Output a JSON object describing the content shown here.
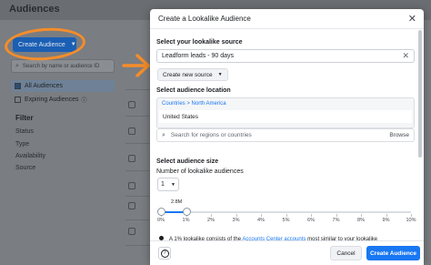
{
  "background": {
    "page_title": "Audiences",
    "create_button": "Create Audience",
    "search_placeholder": "Search by name or audience ID",
    "nav": [
      {
        "label": "All Audiences",
        "active": true
      },
      {
        "label": "Expiring Audiences",
        "active": false
      }
    ],
    "filter_heading": "Filter",
    "filters": [
      "Status",
      "Type",
      "Availability",
      "Source"
    ]
  },
  "modal": {
    "title": "Create a Lookalike Audience",
    "source": {
      "label": "Select your lookalike source",
      "value": "Leadform leads - 90 days",
      "create_new": "Create new source"
    },
    "location": {
      "label": "Select audience location",
      "crumb_a": "Countries",
      "crumb_sep": ">",
      "crumb_b": "North America",
      "selected": "United States",
      "search_placeholder": "Search for regions or countries",
      "browse": "Browse"
    },
    "size": {
      "label": "Select audience size",
      "count_label": "Number of lookalike audiences",
      "count_value": "1",
      "reach": "2.8M",
      "slider_percent": 1,
      "ticks": [
        "0%",
        "1%",
        "2%",
        "3%",
        "4%",
        "5%",
        "6%",
        "7%",
        "8%",
        "9%",
        "10%"
      ]
    },
    "note": {
      "text_a": "A 1% lookalike consists of the",
      "link": "Accounts Center accounts",
      "text_b": "most similar to your lookalike"
    },
    "footer": {
      "help": "?",
      "cancel": "Cancel",
      "create": "Create Audience"
    }
  },
  "colors": {
    "accent": "#1877f2",
    "annotation": "#f58d2a"
  }
}
